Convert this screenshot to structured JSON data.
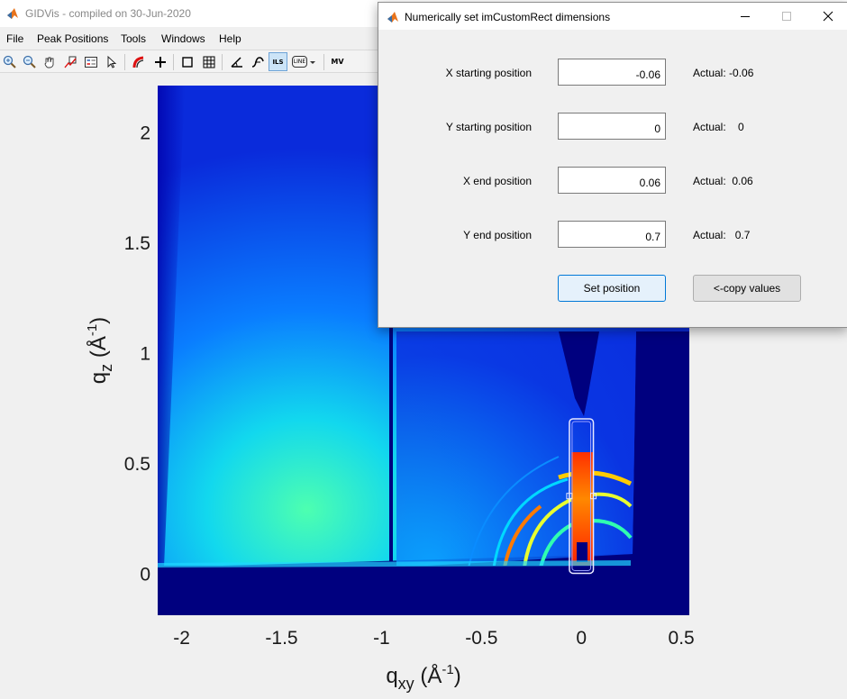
{
  "main_window": {
    "title": "GIDVis - compiled on 30-Jun-2020",
    "menu": [
      "File",
      "Peak Positions",
      "Tools",
      "Windows",
      "Help"
    ],
    "toolbar": {
      "buttons": [
        "zoom-in-icon",
        "zoom-out-icon",
        "pan-icon",
        "data-cursor-icon",
        "legend-icon",
        "select-arrow-icon",
        "color-curve-icon",
        "crosshair-icon",
        "rectangle-icon",
        "grid-icon",
        "angle-icon",
        "integration-icon",
        "ils-icon",
        "line-icon",
        "dropdown-icon",
        "mv-icon"
      ],
      "ils_label": "ILS",
      "line_label": "LINE",
      "mv_label": "MV"
    }
  },
  "chart_data": {
    "type": "heatmap",
    "xlabel": "q",
    "xlabel_sub": "xy",
    "xlabel_unit": "(Å",
    "xlabel_sup": "-1",
    "xlabel_close": ")",
    "ylabel": "q",
    "ylabel_sub": "z",
    "ylabel_unit": "(Å",
    "ylabel_sup": "-1",
    "ylabel_close": ")",
    "xlim": [
      -2.12,
      0.54
    ],
    "ylim": [
      -0.19,
      2.21
    ],
    "x_ticks": [
      -2,
      -1.5,
      -1,
      -0.5,
      0,
      0.5
    ],
    "x_tick_labels": [
      "-2",
      "-1.5",
      "-1",
      "-0.5",
      "0",
      "0.5"
    ],
    "y_ticks": [
      0,
      0.5,
      1,
      1.5,
      2
    ],
    "y_tick_labels": [
      "0",
      "0.5",
      "1",
      "1.5",
      "2"
    ],
    "colormap": "jet",
    "roi_rect": {
      "x0": -0.06,
      "y0": 0,
      "x1": 0.06,
      "y1": 0.7
    },
    "beamstop_x": -0.95,
    "colors": {
      "low": "#00007f",
      "mid": "#00bfff",
      "high": "#ff2000"
    }
  },
  "dialog": {
    "title": "Numerically set imCustomRect dimensions",
    "fields": [
      {
        "label": "X starting position",
        "value": "-0.06",
        "actual_prefix": "Actual:",
        "actual_value": "-0.06",
        "actual": "Actual: -0.06"
      },
      {
        "label": "Y starting position",
        "value": "0",
        "actual_prefix": "Actual:",
        "actual_value": "0",
        "actual": "Actual:    0"
      },
      {
        "label": "X end position",
        "value": "0.06",
        "actual_prefix": "Actual:",
        "actual_value": "0.06",
        "actual": "Actual:  0.06"
      },
      {
        "label": "Y end position",
        "value": "0.7",
        "actual_prefix": "Actual:",
        "actual_value": "0.7",
        "actual": "Actual:   0.7"
      }
    ],
    "set_button": "Set position",
    "copy_button": "<-copy values"
  }
}
